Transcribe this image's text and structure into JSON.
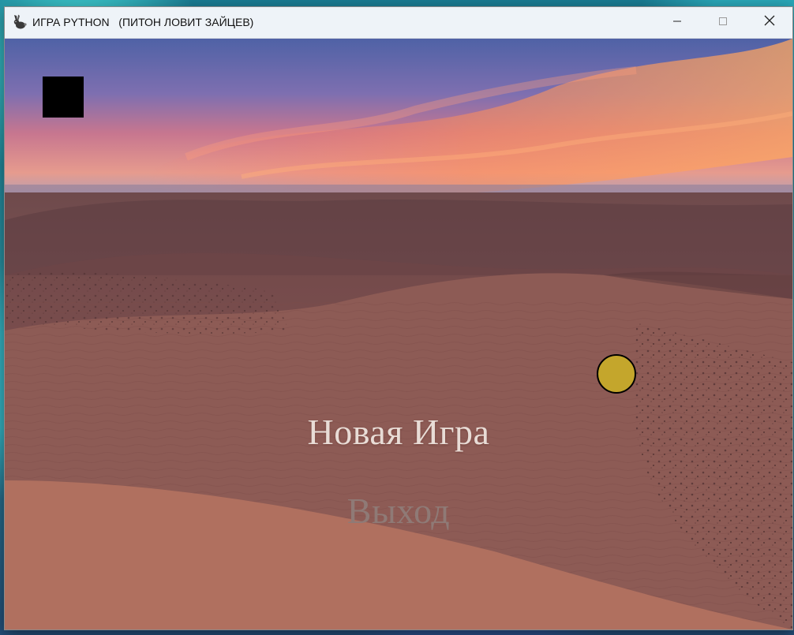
{
  "window": {
    "title": "ИГРА PYTHON   (ПИТОН ЛОВИТ ЗАЙЦЕВ)",
    "app_icon": "rabbit-icon",
    "controls": [
      "minimize-icon",
      "maximize-icon",
      "close-icon"
    ]
  },
  "menu": {
    "new_game": "Новая Игра",
    "exit": "Выход"
  },
  "colors": {
    "ball": "#c4a62c",
    "menu_active": "#e8dcd6",
    "menu_inactive": "#8f7a76",
    "square": "#000000"
  }
}
